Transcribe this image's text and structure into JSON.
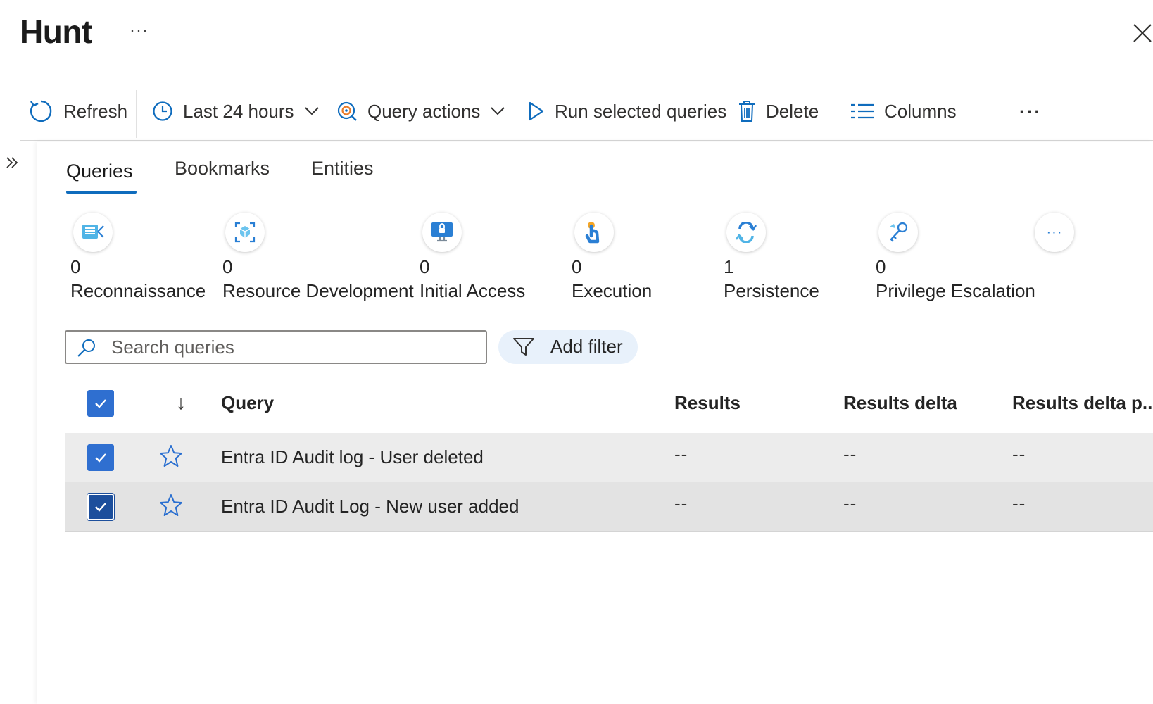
{
  "header": {
    "title": "Hunt",
    "more": "···"
  },
  "toolbar": {
    "refresh": "Refresh",
    "time_range": "Last 24 hours",
    "query_actions": "Query actions",
    "run_selected": "Run selected queries",
    "delete": "Delete",
    "columns": "Columns",
    "more": "···"
  },
  "tabs": [
    "Queries",
    "Bookmarks",
    "Entities"
  ],
  "active_tab": "Queries",
  "tactics": [
    {
      "count": "0",
      "name": "Reconnaissance",
      "icon": "reconnaissance-icon"
    },
    {
      "count": "0",
      "name": "Resource Development",
      "icon": "resource-development-icon"
    },
    {
      "count": "0",
      "name": "Initial Access",
      "icon": "initial-access-icon"
    },
    {
      "count": "0",
      "name": "Execution",
      "icon": "execution-icon"
    },
    {
      "count": "1",
      "name": "Persistence",
      "icon": "persistence-icon"
    },
    {
      "count": "0",
      "name": "Privilege Escalation",
      "icon": "privilege-escalation-icon"
    }
  ],
  "tactics_more": "···",
  "search": {
    "placeholder": "Search queries",
    "value": ""
  },
  "add_filter": "Add filter",
  "table": {
    "sort_indicator": "↓",
    "columns": [
      "Query",
      "Results",
      "Results delta",
      "Results delta p..."
    ],
    "rows": [
      {
        "query": "Entra ID Audit log - User deleted",
        "results": "--",
        "results_delta": "--",
        "results_delta_pct": "--",
        "checked": true
      },
      {
        "query": "Entra ID Audit Log - New user added",
        "results": "--",
        "results_delta": "--",
        "results_delta_pct": "--",
        "checked": true
      }
    ]
  },
  "colors": {
    "accent": "#0f6cbd",
    "checkbox": "#2f6fd0",
    "checkbox_focused": "#1d4f9c",
    "filter_bg": "#e8f1fb"
  }
}
